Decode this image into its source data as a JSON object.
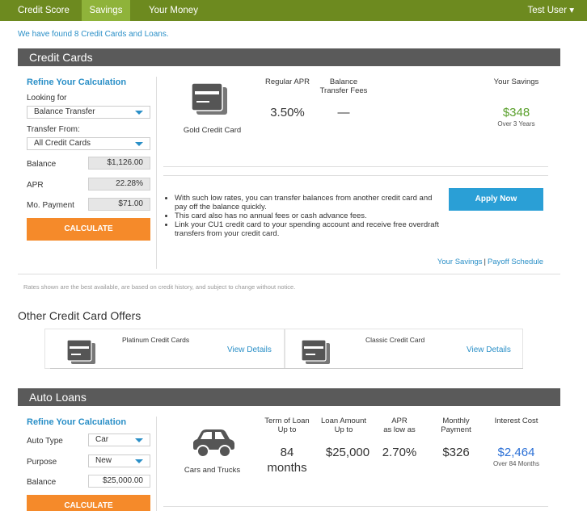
{
  "nav": {
    "tabs": [
      "Credit Score",
      "Savings",
      "Your Money"
    ],
    "user": "Test User ▾"
  },
  "found_text": "We have found 8 Credit Cards and Loans.",
  "credit": {
    "section_title": "Credit Cards",
    "refine_title": "Refine Your Calculation",
    "looking_for_label": "Looking for",
    "looking_for_value": "Balance Transfer",
    "transfer_from_label": "Transfer From:",
    "transfer_from_value": "All Credit Cards",
    "balance_label": "Balance",
    "balance_value": "$1,126.00",
    "apr_label": "APR",
    "apr_value": "22.28%",
    "payment_label": "Mo. Payment",
    "payment_value": "$71.00",
    "calculate": "CALCULATE",
    "product_name": "Gold Credit Card",
    "col_regular_apr": "Regular APR",
    "col_balance_fees": "Balance\nTransfer Fees",
    "col_savings": "Your Savings",
    "regular_apr": "3.50%",
    "balance_fees": "—",
    "savings": "$348",
    "savings_note": "Over 3 Years",
    "bullets": [
      "With such low rates, you can transfer balances from another credit card and pay off the balance quickly.",
      "This card also has no annual fees or cash advance fees.",
      "Link your CU1 credit card to your spending account and receive free overdraft transfers from your credit card."
    ],
    "apply": "Apply Now",
    "link_savings": "Your Savings",
    "link_separator": "|",
    "link_schedule": "Payoff Schedule",
    "disclaimer": "Rates shown are the best available, are based on credit history, and subject to change without notice."
  },
  "other": {
    "title": "Other Credit Card Offers",
    "offers": [
      {
        "name": "Platinum Credit Cards",
        "link": "View Details"
      },
      {
        "name": "Classic Credit Card",
        "link": "View Details"
      }
    ]
  },
  "auto": {
    "section_title": "Auto Loans",
    "refine_title": "Refine Your Calculation",
    "auto_type_label": "Auto Type",
    "auto_type_value": "Car",
    "purpose_label": "Purpose",
    "purpose_value": "New",
    "balance_label": "Balance",
    "balance_value": "$25,000.00",
    "calculate": "CALCULATE",
    "product_name": "Cars and Trucks",
    "col_term": "Term of Loan\nUp to",
    "col_amount": "Loan Amount\nUp to",
    "col_apr": "APR\nas low as",
    "col_payment": "Monthly\nPayment",
    "col_interest": "Interest Cost",
    "term_number": "84",
    "term_unit": "months",
    "amount": "$25,000",
    "apr": "2.70%",
    "payment": "$326",
    "interest": "$2,464",
    "interest_note": "Over 84 Months"
  }
}
